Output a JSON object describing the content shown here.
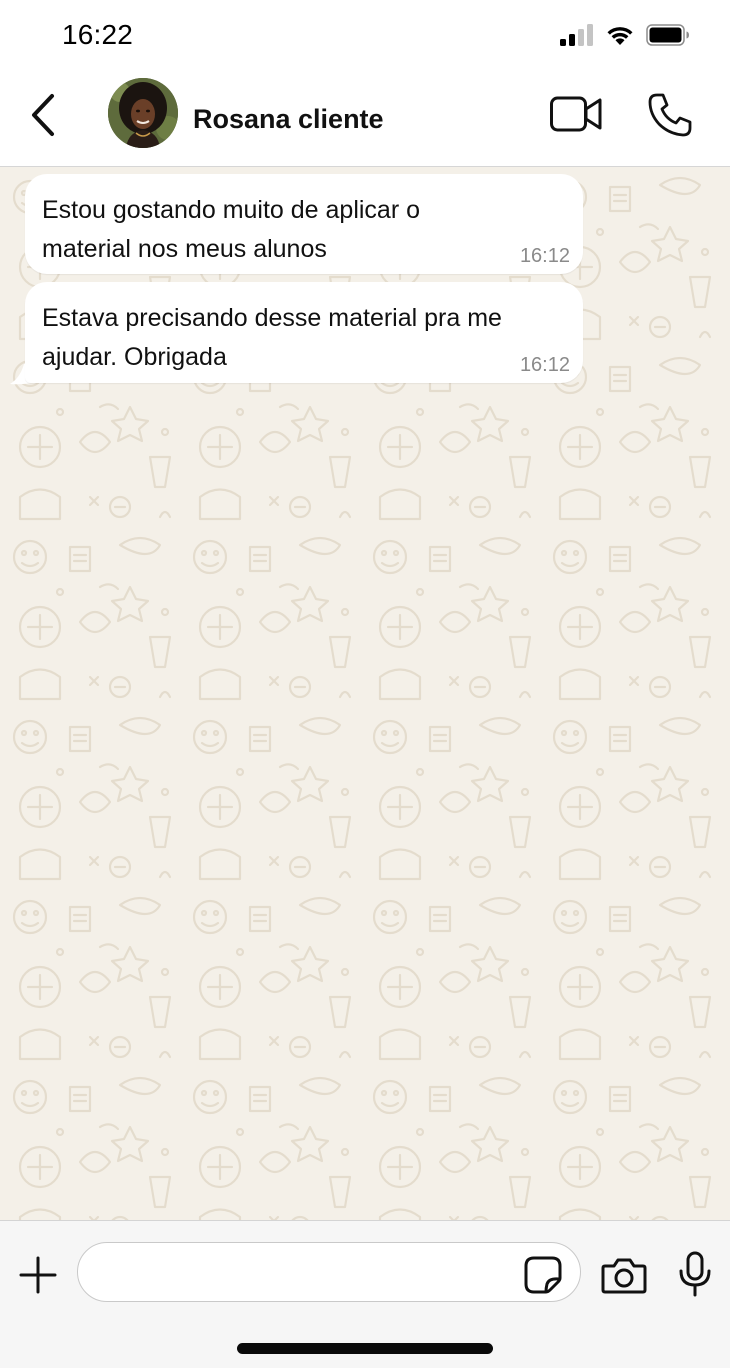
{
  "status_bar": {
    "time": "16:22",
    "icons": [
      "signal-icon",
      "wifi-icon",
      "battery-icon"
    ]
  },
  "header": {
    "contact_name": "Rosana cliente",
    "icons": [
      "back-icon",
      "avatar",
      "video-call-icon",
      "phone-icon"
    ]
  },
  "messages": [
    {
      "text": "Estou gostando muito de aplicar o\nmaterial nos meus alunos",
      "time": "16:12",
      "direction": "incoming"
    },
    {
      "text": "Estava precisando desse material pra me\najudar. Obrigada",
      "time": "16:12",
      "direction": "incoming"
    }
  ],
  "input_bar": {
    "placeholder": "",
    "icons": [
      "plus-icon",
      "sticker-icon",
      "camera-icon",
      "microphone-icon"
    ]
  },
  "colors": {
    "chat_background": "#f4f0e8",
    "bubble": "#ffffff",
    "timestamp": "#8a8a8a",
    "wallpaper_doodle": "#e4dccd"
  }
}
